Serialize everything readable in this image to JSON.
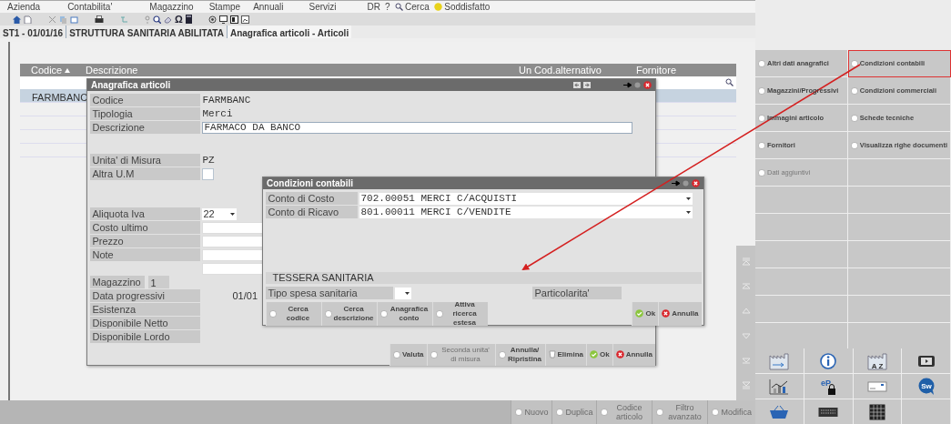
{
  "menu": [
    {
      "label": "Azienda"
    },
    {
      "label": "Contabilita'"
    },
    {
      "label": "Magazzino"
    },
    {
      "label": "Stampe"
    },
    {
      "label": "Annuali"
    },
    {
      "label": "Servizi"
    }
  ],
  "menu_right": [
    {
      "label": "DR",
      "kind": "text"
    },
    {
      "label": "?",
      "kind": "text"
    },
    {
      "label": "Cerca",
      "kind": "search"
    },
    {
      "label": "Soddisfatto",
      "kind": "emoji"
    }
  ],
  "toolbar": [
    {
      "kind": "home"
    },
    {
      "kind": "document"
    },
    {
      "kind": "sep"
    },
    {
      "kind": "scissors"
    },
    {
      "kind": "copy"
    },
    {
      "kind": "paste"
    },
    {
      "kind": "sep"
    },
    {
      "kind": "printer"
    },
    {
      "kind": "sep"
    },
    {
      "kind": "tree"
    },
    {
      "kind": "sep"
    },
    {
      "kind": "help"
    },
    {
      "kind": "zoom"
    },
    {
      "kind": "eraser"
    },
    {
      "kind": "glyph",
      "text": "Ω"
    },
    {
      "kind": "calculator"
    },
    {
      "kind": "sep"
    },
    {
      "kind": "target"
    },
    {
      "kind": "monitor"
    },
    {
      "kind": "panel"
    },
    {
      "kind": "image"
    }
  ],
  "breadcrumb": {
    "company": "ST1 - 01/01/16",
    "title": "STRUTTURA SANITARIA ABILITATA",
    "tab": "Anagrafica articoli - Articoli"
  },
  "table": {
    "columns": [
      {
        "label": "Codice",
        "sorted": true
      },
      {
        "label": "Descrizione",
        "sorted": false
      },
      {
        "label": "Un",
        "sorted": false
      },
      {
        "label": "Cod.alternativo",
        "sorted": false
      },
      {
        "label": "Fornitore",
        "sorted": false
      }
    ],
    "rows": [
      {
        "cells": [
          "FARMBANC"
        ],
        "selected": true
      }
    ]
  },
  "record_dialog": {
    "title": "Anagrafica articoli",
    "sections": [
      [
        {
          "kind": "text",
          "label": "Codice",
          "value": "FARMBANC"
        },
        {
          "kind": "text",
          "label": "Tipologia",
          "value": "Merci"
        },
        {
          "kind": "input",
          "label": "Descrizione",
          "value": "FARMACO DA BANCO"
        }
      ],
      [
        {
          "kind": "text",
          "label": "Unita' di Misura",
          "value": "PZ"
        },
        {
          "kind": "checkbox",
          "label": "Altra U.M",
          "checked": false
        }
      ],
      [
        {
          "kind": "select",
          "label": "Aliquota Iva",
          "value": "22"
        },
        {
          "kind": "input",
          "label": "Costo ultimo"
        },
        {
          "kind": "input",
          "label": "Prezzo"
        },
        {
          "kind": "input",
          "label": "Note"
        },
        {
          "kind": "input"
        }
      ],
      [
        {
          "kind": "short",
          "label": "Magazzino",
          "value": "1"
        },
        {
          "kind": "text",
          "label": "Data progressivi",
          "value": "01/01"
        },
        {
          "kind": "text",
          "label": "Esistenza"
        },
        {
          "kind": "text",
          "label": "Disponibile Netto"
        },
        {
          "kind": "text",
          "label": "Disponibile Lordo"
        }
      ]
    ],
    "buttons": [
      {
        "label": "Valuta",
        "kind": "key",
        "disabled": false
      },
      {
        "label": "Seconda unita' di misura",
        "kind": "key",
        "disabled": true
      },
      {
        "label": "Annulla/ Ripristina",
        "kind": "key",
        "disabled": false
      },
      {
        "label": "Elimina",
        "kind": "trash",
        "disabled": false
      },
      {
        "label": "Ok",
        "kind": "check",
        "disabled": false
      },
      {
        "label": "Annulla",
        "kind": "cross",
        "disabled": false
      }
    ]
  },
  "accounting_dialog": {
    "title": "Condizioni contabili",
    "accounts": [
      {
        "label": "Conto di Costo",
        "value": "702.00051 MERCI C/ACQUISTI"
      },
      {
        "label": "Conto di Ricavo",
        "value": "801.00011 MERCI C/VENDITE"
      }
    ],
    "section": "TESSERA SANITARIA",
    "health_fields": [
      {
        "kind": "select",
        "label": "Tipo spesa sanitaria"
      },
      {
        "kind": "text",
        "label": "Particolarita'"
      }
    ],
    "buttons": [
      {
        "label": "Cerca codice",
        "kind": "key"
      },
      {
        "label": "Cerca descrizione",
        "kind": "key"
      },
      {
        "label": "Anagrafica conto",
        "kind": "key"
      },
      {
        "label": "Attiva ricerca estesa",
        "kind": "key"
      },
      {
        "label": "Ok",
        "kind": "check"
      },
      {
        "label": "Annulla",
        "kind": "cross"
      }
    ]
  },
  "side_actions": [
    {
      "label": "Altri dati anagrafici",
      "highlighted": false,
      "disabled": false
    },
    {
      "label": "Condizioni contabili",
      "highlighted": true,
      "disabled": false
    },
    {
      "label": "Magazzini/Progressivi",
      "highlighted": false,
      "disabled": false
    },
    {
      "label": "Condizioni commerciali",
      "highlighted": false,
      "disabled": false
    },
    {
      "label": "Immagini articolo",
      "highlighted": false,
      "disabled": false
    },
    {
      "label": "Schede tecniche",
      "highlighted": false,
      "disabled": false
    },
    {
      "label": "Fornitori",
      "highlighted": false,
      "disabled": false
    },
    {
      "label": "Visualizza righe documenti",
      "highlighted": false,
      "disabled": false
    },
    {
      "label": "Dati aggiuntivi",
      "highlighted": false,
      "disabled": true
    }
  ],
  "shortcut_icons": [
    {
      "kind": "factory"
    },
    {
      "kind": "info"
    },
    {
      "kind": "factory",
      "text": "A Z"
    },
    {
      "kind": "video"
    },
    {
      "kind": "chart"
    },
    {
      "kind": "lock",
      "text": "eP"
    },
    {
      "kind": "card"
    },
    {
      "kind": "bubble",
      "text": "Sw"
    },
    {
      "kind": "basket"
    },
    {
      "kind": "keyboard"
    },
    {
      "kind": "grid"
    }
  ],
  "bottom_actions": [
    {
      "label": "Nuovo",
      "disabled": true
    },
    {
      "label": "Duplica",
      "disabled": true
    },
    {
      "label": "Codice articolo",
      "disabled": true
    },
    {
      "label": "Filtro avanzato",
      "disabled": true
    },
    {
      "label": "Modifica",
      "disabled": true
    }
  ]
}
